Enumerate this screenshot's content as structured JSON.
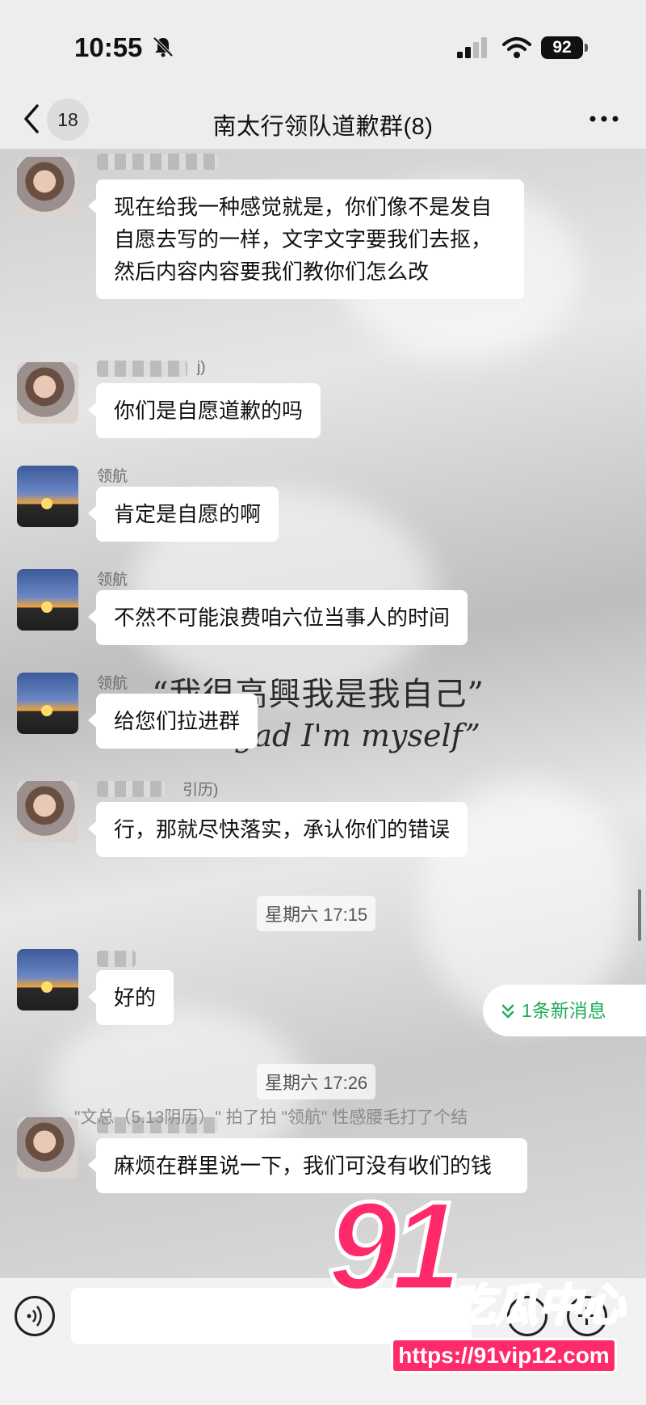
{
  "status_bar": {
    "time": "10:55",
    "battery": "92"
  },
  "nav": {
    "unread_count": "18",
    "title": "南太行领队道歉群(8)"
  },
  "messages": [
    {
      "sender": "",
      "text": "现在给我一种感觉就是，你们像不是发自自愿去写的一样，文字文字要我们去抠，然后内容内容要我们教你们怎么改"
    },
    {
      "sender": "j)",
      "text": "你们是自愿道歉的吗"
    },
    {
      "sender": "领航",
      "text": "肯定是自愿的啊"
    },
    {
      "sender": "领航",
      "text": "不然不可能浪费咱六位当事人的时间"
    },
    {
      "sender": "领航",
      "text": "给您们拉进群"
    },
    {
      "sender": "引历)",
      "text": "行，那就尽快落实，承认你们的错误"
    },
    {
      "sender": "",
      "text": "好的"
    },
    {
      "sender": "",
      "text": "麻烦在群里说一下，我们可没有收们的钱"
    }
  ],
  "timestamps": [
    "星期六 17:15",
    "星期六 17:26"
  ],
  "background_quote": {
    "line1": "“我很高興我是我自己”",
    "line2": "gad I'm myself”"
  },
  "new_message_pill": "1条新消息",
  "system_note": "\"文总（5.13阴历）\" 拍了拍 \"领航\" 性感腰毛打了个结",
  "watermark": {
    "number": "91",
    "brand": "吃瓜中心",
    "url": "https://91vip12.com"
  },
  "colors": {
    "accent_green": "#1faa59",
    "watermark_pink": "#ff2a6a"
  }
}
